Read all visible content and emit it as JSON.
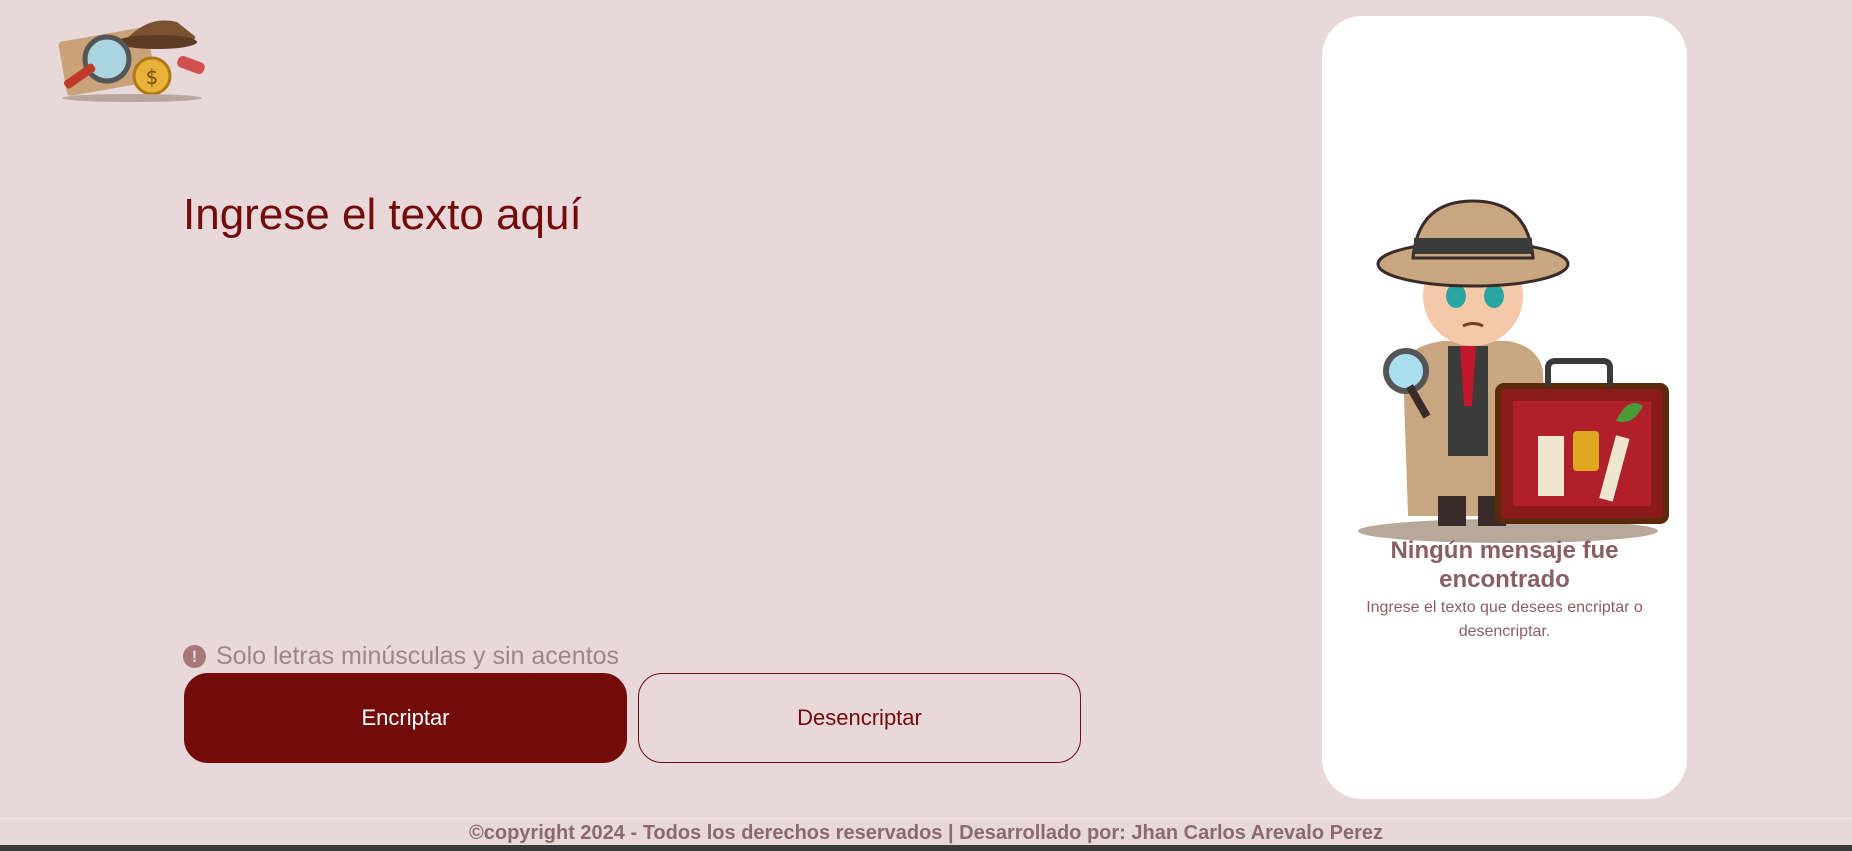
{
  "colors": {
    "accent": "#740b0b",
    "background": "#e8d8da",
    "panel": "#ffffff",
    "muted_text": "#8a5e66"
  },
  "header": {
    "logo_icon": "detective-tools-logo"
  },
  "main": {
    "input_placeholder": "Ingrese el texto aquí",
    "hint_icon": "exclamation-circle-icon",
    "hint_text": "Solo letras minúsculas y sin acentos",
    "encrypt_label": "Encriptar",
    "decrypt_label": "Desencriptar"
  },
  "panel": {
    "illustration": "detective-with-briefcase",
    "title": "Ningún mensaje fue encontrado",
    "text": "Ingrese el texto que desees encriptar o desencriptar."
  },
  "footer": {
    "text": "©copyright 2024 - Todos los derechos reservados | Desarrollado por: Jhan Carlos Arevalo Perez"
  }
}
